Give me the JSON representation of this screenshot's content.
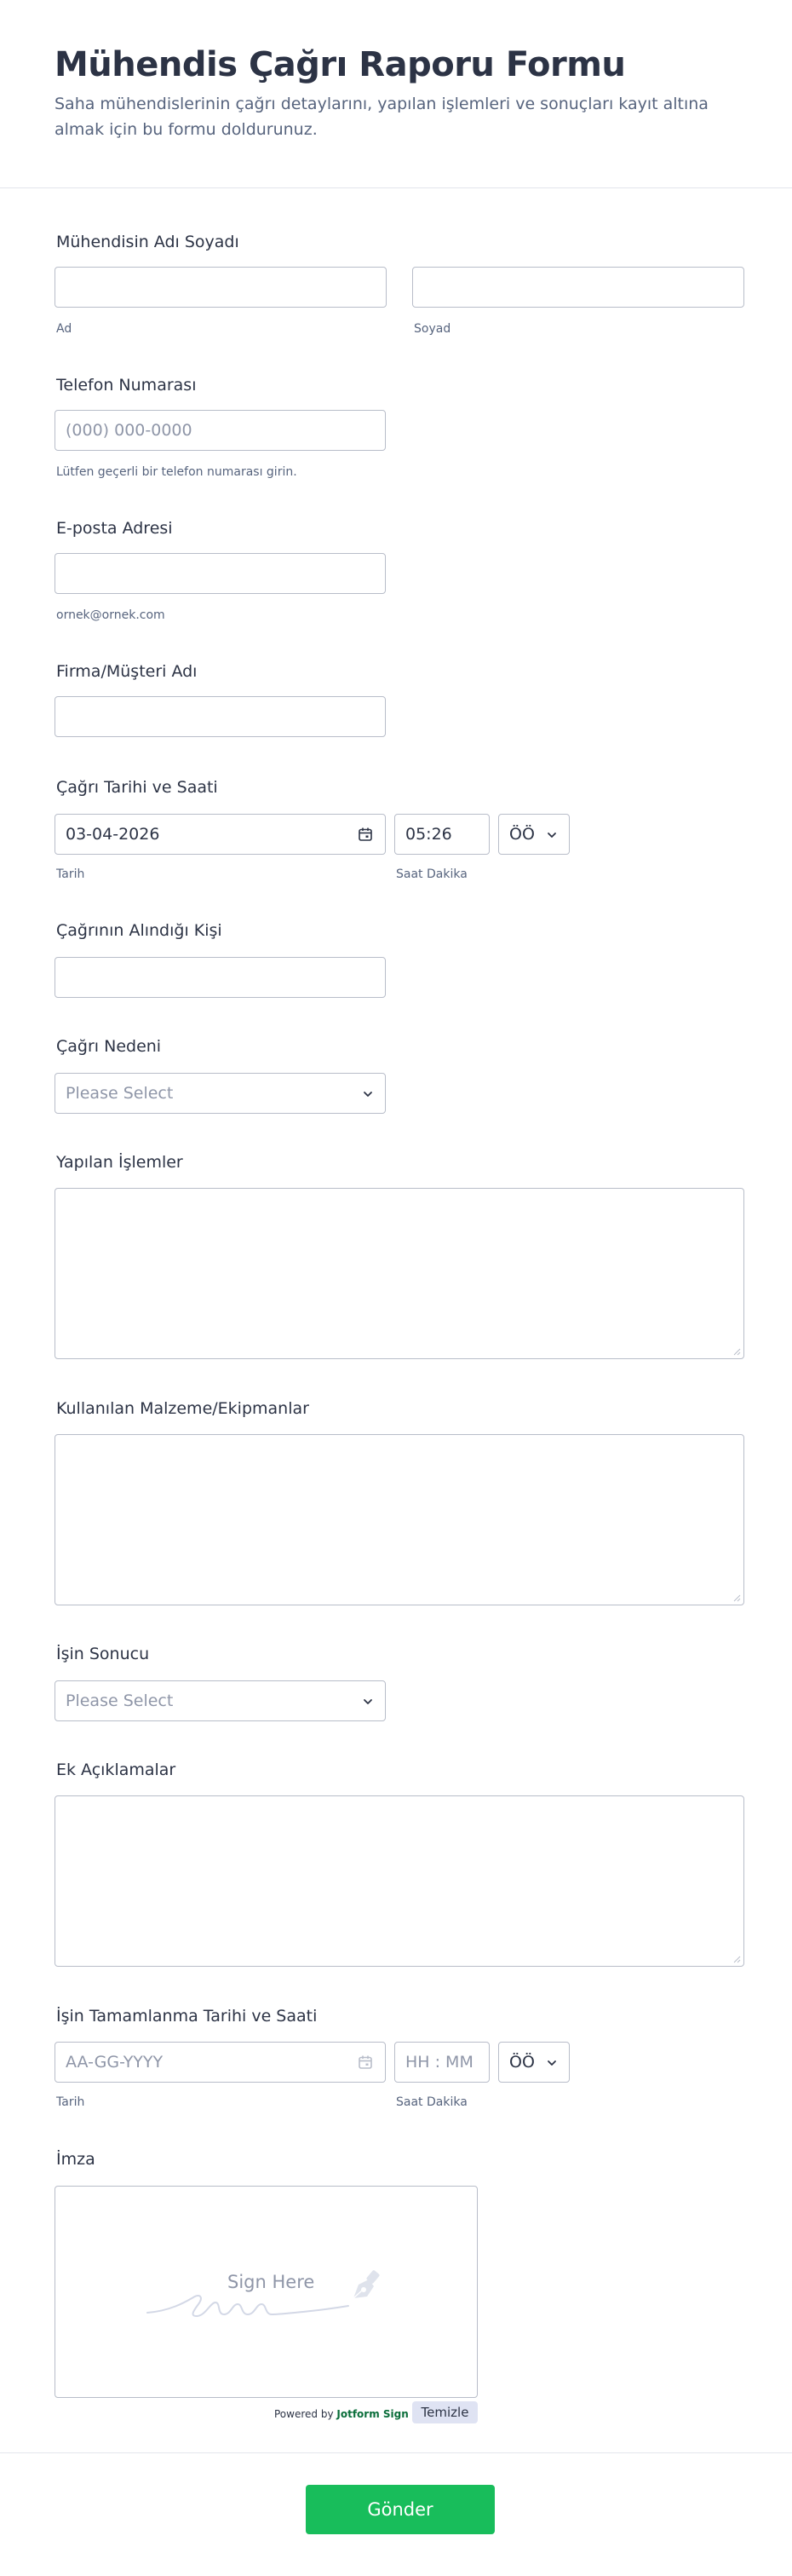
{
  "header": {
    "title": "Mühendis Çağrı Raporu Formu",
    "subtitle": "Saha mühendislerinin çağrı detaylarını, yapılan işlemleri ve sonuçları kayıt altına almak için bu formu doldurunuz."
  },
  "fields": {
    "engineer_name": {
      "label": "Mühendisin Adı Soyadı",
      "first_sub": "Ad",
      "last_sub": "Soyad",
      "first_value": "",
      "last_value": ""
    },
    "phone": {
      "label": "Telefon Numarası",
      "placeholder": "(000) 000-0000",
      "help": "Lütfen geçerli bir telefon numarası girin."
    },
    "email": {
      "label": "E-posta Adresi",
      "help": "ornek@ornek.com",
      "value": ""
    },
    "company": {
      "label": "Firma/Müşteri Adı",
      "value": ""
    },
    "call_datetime": {
      "label": "Çağrı Tarihi ve Saati",
      "date_value": "03-04-2026",
      "time_value": "05:26",
      "ampm_value": "ÖÖ",
      "date_sub": "Tarih",
      "time_sub": "Saat Dakika"
    },
    "call_from": {
      "label": "Çağrının Alındığı Kişi",
      "value": ""
    },
    "call_reason": {
      "label": "Çağrı Nedeni",
      "placeholder": "Please Select"
    },
    "actions_taken": {
      "label": "Yapılan İşlemler"
    },
    "materials": {
      "label": "Kullanılan Malzeme/Ekipmanlar"
    },
    "result": {
      "label": "İşin Sonucu",
      "placeholder": "Please Select"
    },
    "notes": {
      "label": "Ek Açıklamalar"
    },
    "completion_datetime": {
      "label": "İşin Tamamlanma Tarihi ve Saati",
      "date_placeholder": "AA-GG-YYYY",
      "time_placeholder": "HH : MM",
      "ampm_value": "ÖÖ",
      "date_sub": "Tarih",
      "time_sub": "Saat Dakika"
    },
    "signature": {
      "label": "İmza",
      "sign_here": "Sign Here",
      "powered_prefix": "Powered by",
      "powered_brand": "Jotform Sign",
      "clear_label": "Temizle"
    }
  },
  "submit_label": "Gönder",
  "colors": {
    "submit": "#18bd5b",
    "text": "#2c3345",
    "muted": "#57647e",
    "border": "#b8bdc9",
    "placeholder": "#8f96a8"
  },
  "icons": [
    "calendar-icon",
    "chevron-down-icon",
    "resize-grip-icon",
    "pen-icon"
  ]
}
